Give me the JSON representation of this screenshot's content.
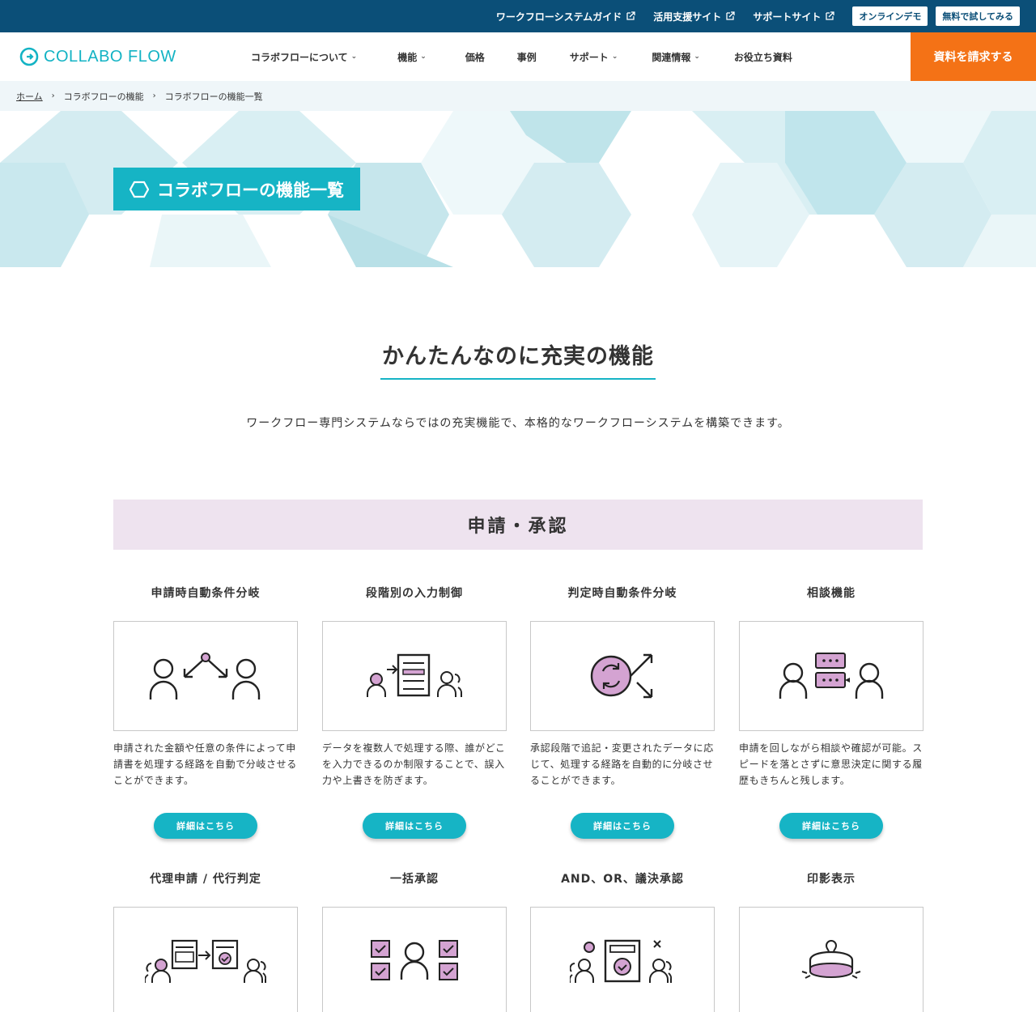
{
  "topbar": {
    "links": [
      {
        "label": "ワークフローシステムガイド"
      },
      {
        "label": "活用支援サイト"
      },
      {
        "label": "サポートサイト"
      }
    ],
    "buttons": [
      {
        "label": "オンラインデモ"
      },
      {
        "label": "無料で試してみる"
      }
    ]
  },
  "header": {
    "logo_text": "COLLABO FLOW",
    "nav": [
      {
        "label": "コラボフローについて",
        "dropdown": true
      },
      {
        "label": "機能",
        "dropdown": true
      },
      {
        "label": "価格",
        "dropdown": false
      },
      {
        "label": "事例",
        "dropdown": false
      },
      {
        "label": "サポート",
        "dropdown": true
      },
      {
        "label": "関連情報",
        "dropdown": true
      },
      {
        "label": "お役立ち資料",
        "dropdown": false
      }
    ],
    "cta_label": "資料を請求する"
  },
  "breadcrumb": {
    "items": [
      "ホーム",
      "コラボフローの機能",
      "コラボフローの機能一覧"
    ]
  },
  "hero": {
    "title": "コラボフローの機能一覧"
  },
  "section": {
    "title": "かんたんなのに充実の機能",
    "description": "ワークフロー専門システムならではの充実機能で、本格的なワークフローシステムを構築できます。"
  },
  "category": {
    "title": "申請・承認"
  },
  "features": [
    {
      "title": "申請時自動条件分岐",
      "icon": "branch-icon",
      "desc": "申請された金額や任意の条件によって申請書を処理する経路を自動で分岐させることができます。",
      "button": "詳細はこちら"
    },
    {
      "title": "段階別の入力制御",
      "icon": "input-control-icon",
      "desc": "データを複数人で処理する際、誰がどこを入力できるのか制限することで、誤入力や上書きを防ぎます。",
      "button": "詳細はこちら"
    },
    {
      "title": "判定時自動条件分岐",
      "icon": "auto-judge-icon",
      "desc": "承認段階で追記・変更されたデータに応じて、処理する経路を自動的に分岐させることができます。",
      "button": "詳細はこちら"
    },
    {
      "title": "相談機能",
      "icon": "consult-icon",
      "desc": "申請を回しながら相談や確認が可能。スピードを落とさずに意思決定に関する履歴もきちんと残します。",
      "button": "詳細はこちら"
    },
    {
      "title": "代理申請 / 代行判定",
      "icon": "proxy-icon",
      "desc": "",
      "button": ""
    },
    {
      "title": "一括承認",
      "icon": "bulk-approve-icon",
      "desc": "",
      "button": ""
    },
    {
      "title": "AND、OR、議決承認",
      "icon": "and-or-icon",
      "desc": "",
      "button": ""
    },
    {
      "title": "印影表示",
      "icon": "stamp-icon",
      "desc": "",
      "button": ""
    }
  ],
  "colors": {
    "topbar": "#0b4f78",
    "accent": "#16b4c5",
    "cta": "#f47216",
    "category_bg": "#eee3ef",
    "icon_fill": "#d4a3d2"
  }
}
